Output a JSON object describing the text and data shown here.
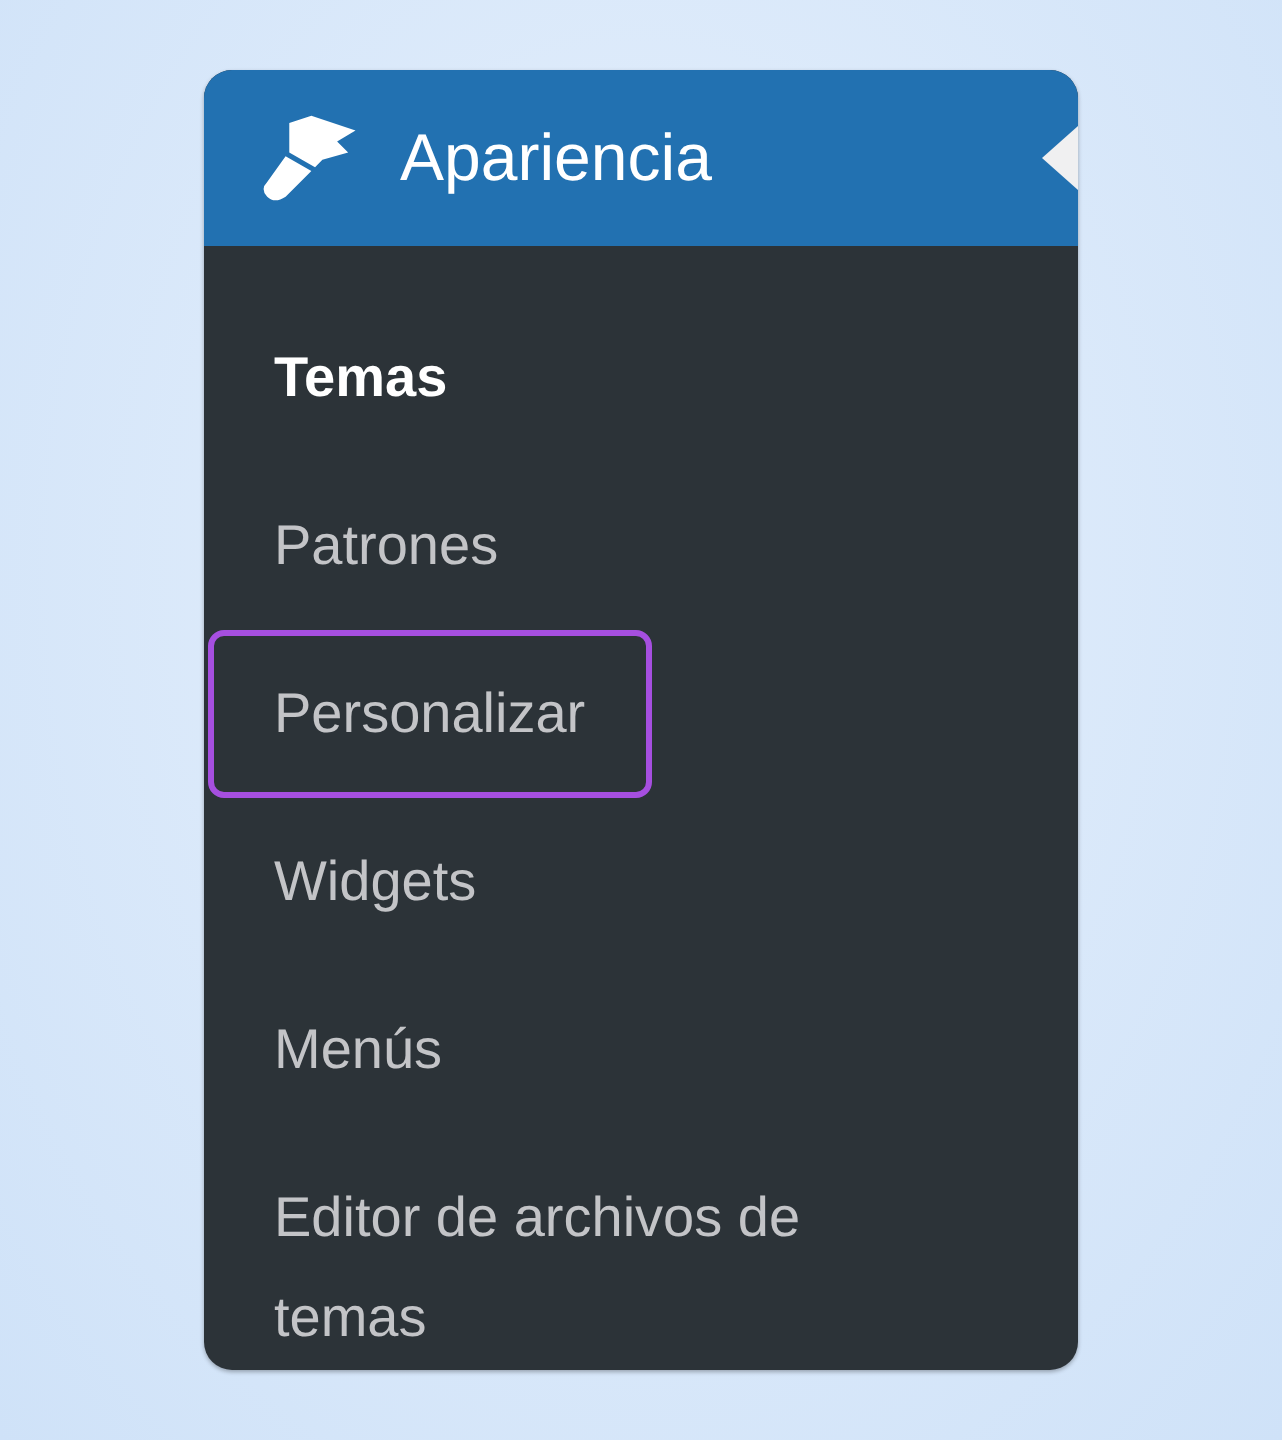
{
  "menu": {
    "title": "Apariencia",
    "items": [
      {
        "label": "Temas",
        "selected": true,
        "highlighted": false
      },
      {
        "label": "Patrones",
        "selected": false,
        "highlighted": false
      },
      {
        "label": "Personalizar",
        "selected": false,
        "highlighted": true
      },
      {
        "label": "Widgets",
        "selected": false,
        "highlighted": false
      },
      {
        "label": "Menús",
        "selected": false,
        "highlighted": false
      },
      {
        "label": "Editor de archivos de temas",
        "selected": false,
        "highlighted": false
      }
    ]
  }
}
